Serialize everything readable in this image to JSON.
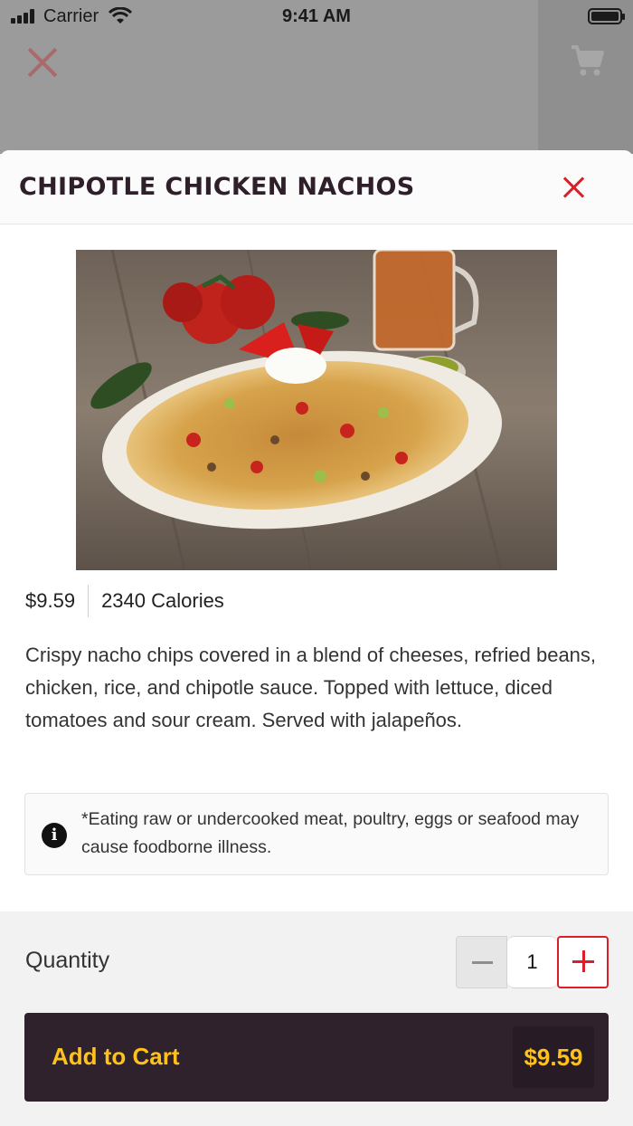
{
  "status_bar": {
    "carrier": "Carrier",
    "time": "9:41 AM"
  },
  "background": {
    "close_icon": "close-icon",
    "cart_icon": "cart-icon"
  },
  "item": {
    "title": "CHIPOTLE CHICKEN NACHOS",
    "photo_alt": "Chipotle Chicken Nachos",
    "price": "$9.59",
    "calories": "2340 Calories",
    "description": "Crispy nacho chips covered in a blend of cheeses, refried beans, chicken, rice, and chipotle sauce. Topped with lettuce, diced tomatoes and sour cream. Served with jalapeños.",
    "notice": "*Eating raw or undercooked meat, poultry, eggs or seafood may cause foodborne illness."
  },
  "order": {
    "quantity_label": "Quantity",
    "quantity": "1",
    "add_label": "Add to Cart",
    "total": "$9.59"
  },
  "colors": {
    "accent_red": "#d9202a",
    "button_bg": "#2f222d",
    "button_text": "#ffc21c"
  }
}
